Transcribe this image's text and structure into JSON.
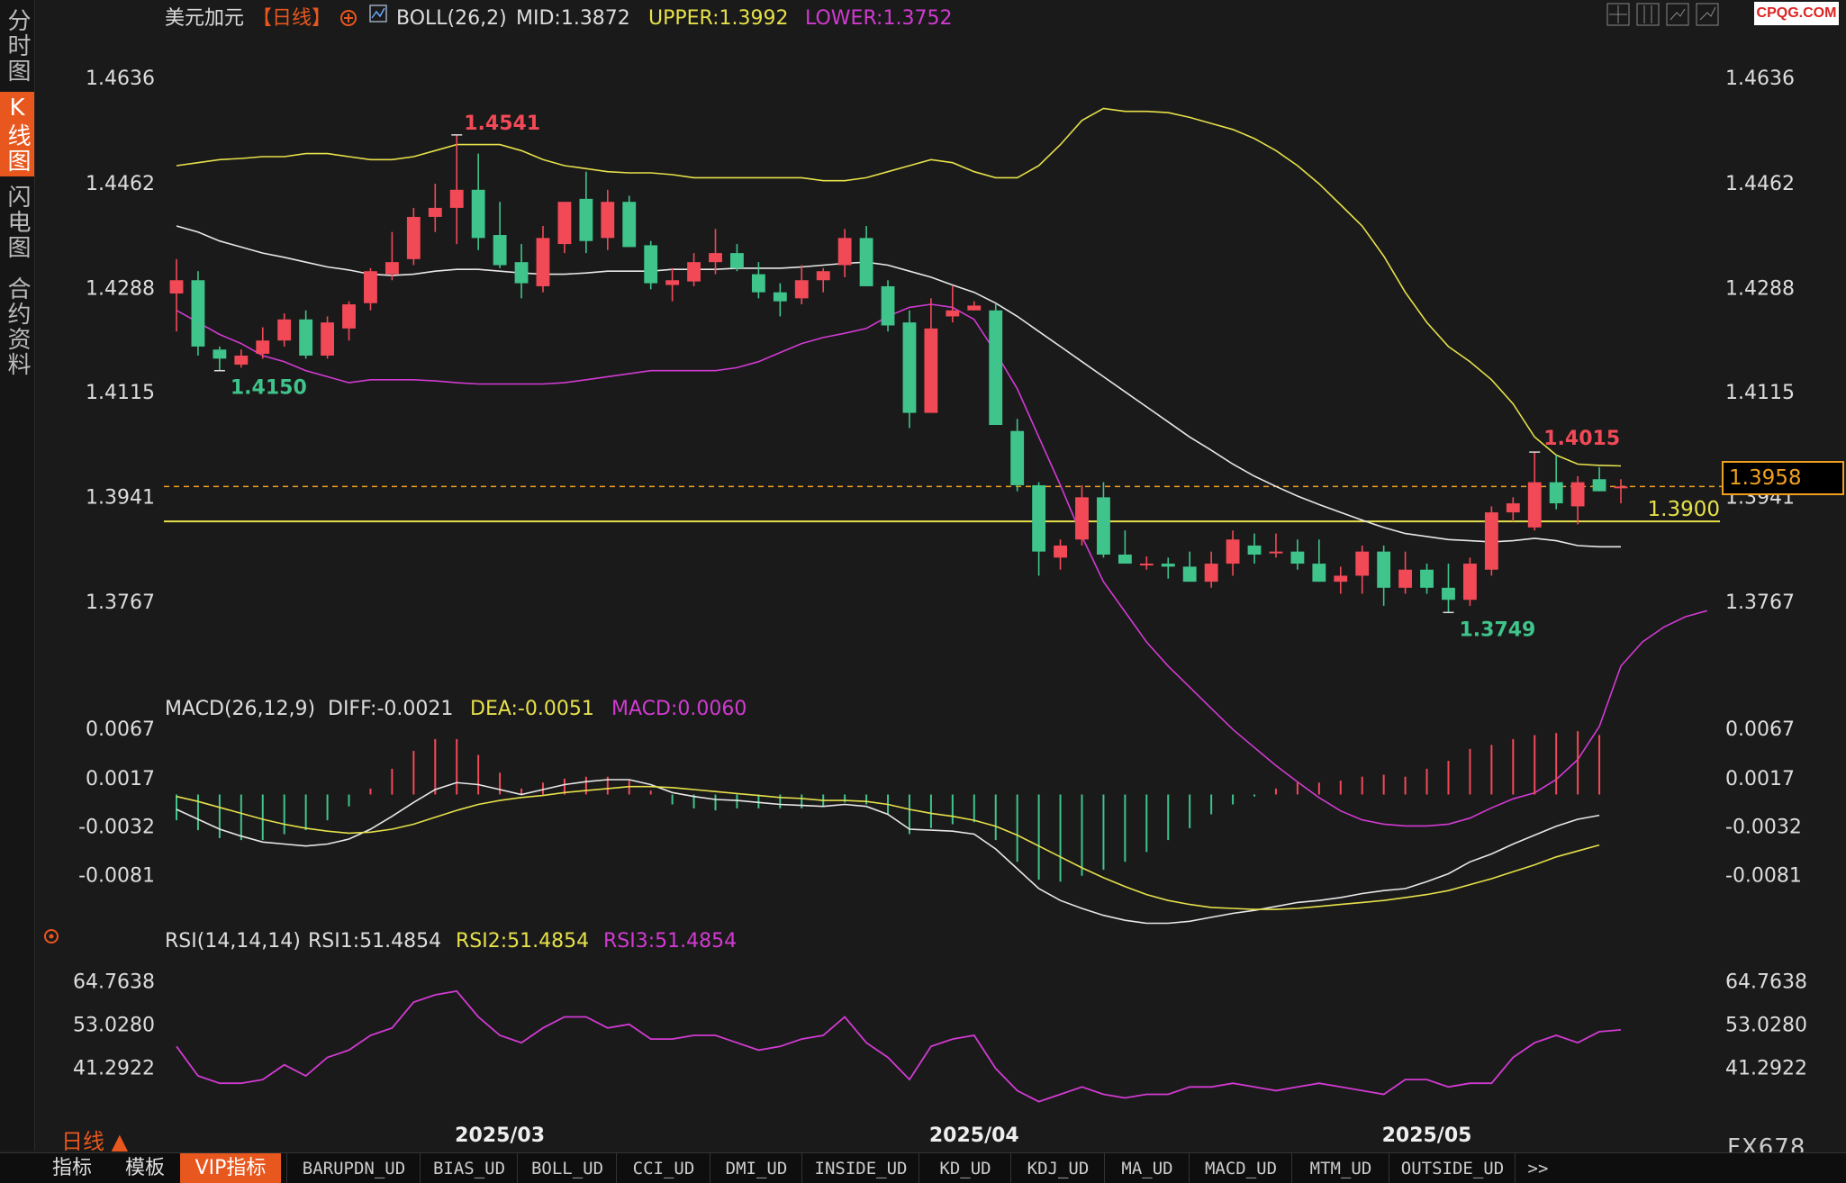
{
  "sidebar": {
    "tabs": [
      {
        "label": "分时图",
        "active": false
      },
      {
        "label": "K线图",
        "active": true
      },
      {
        "label": "闪电图",
        "active": false
      },
      {
        "label": "合约资料",
        "active": false
      }
    ]
  },
  "header": {
    "symbol_title": "美元加元",
    "period_tag": "【日线】",
    "boll_label": "BOLL(26,2)",
    "boll_mid": "MID:1.3872",
    "boll_upper": "UPPER:1.3992",
    "boll_lower": "LOWER:1.3752"
  },
  "macd_header": {
    "label": "MACD(26,12,9)",
    "diff": "DIFF:-0.0021",
    "dea": "DEA:-0.0051",
    "macd": "MACD:0.0060"
  },
  "rsi_header": {
    "label": "RSI(14,14,14)",
    "rsi1": "RSI1:51.4854",
    "rsi2": "RSI2:51.4854",
    "rsi3": "RSI3:51.4854"
  },
  "watermark": "CPQG.COM",
  "current_price": "1.3958",
  "brand": "FX678",
  "period_label": "日线 ▲",
  "bottom_tabs": {
    "indicators": "指标",
    "templates": "模板",
    "vip": "VIP指标"
  },
  "indicator_tabs": [
    "BARUPDN_UD",
    "BIAS_UD",
    "BOLL_UD",
    "CCI_UD",
    "DMI_UD",
    "INSIDE_UD",
    "KD_UD",
    "KDJ_UD",
    "MA_UD",
    "MACD_UD",
    "MTM_UD",
    "OUTSIDE_UD",
    ">>"
  ],
  "colors": {
    "up": "#f24957",
    "down": "#3fc48b",
    "mid": "#e8e8e8",
    "upper": "#e6e04a",
    "lower": "#d23ad2",
    "accent": "#e8571e"
  },
  "chart_data": [
    {
      "type": "candlestick",
      "title": "美元加元【日线】",
      "ylim": [
        1.363,
        1.4705
      ],
      "yticks": [
        "1.4636",
        "1.4462",
        "1.4288",
        "1.4115",
        "1.3941",
        "1.3767"
      ],
      "xticks": [
        "2025/03",
        "2025/04",
        "2025/05"
      ],
      "annotations": {
        "high": "1.4541",
        "low_left": "1.4150",
        "low_right": "1.3749",
        "recent_high": "1.4015",
        "hline": "1.3900"
      },
      "hline_value": 1.39,
      "dashed_line_value": 1.3958,
      "ohlc": [
        [
          1.4278,
          1.4335,
          1.4215,
          1.43
        ],
        [
          1.43,
          1.4315,
          1.4175,
          1.419
        ],
        [
          1.4185,
          1.419,
          1.415,
          1.417
        ],
        [
          1.416,
          1.4185,
          1.4155,
          1.4175
        ],
        [
          1.4178,
          1.4222,
          1.417,
          1.42
        ],
        [
          1.42,
          1.4245,
          1.419,
          1.4235
        ],
        [
          1.4235,
          1.425,
          1.417,
          1.4175
        ],
        [
          1.4175,
          1.424,
          1.417,
          1.423
        ],
        [
          1.422,
          1.4265,
          1.42,
          1.426
        ],
        [
          1.4262,
          1.432,
          1.425,
          1.4315
        ],
        [
          1.431,
          1.438,
          1.43,
          1.433
        ],
        [
          1.4335,
          1.442,
          1.4325,
          1.4405
        ],
        [
          1.4405,
          1.446,
          1.438,
          1.442
        ],
        [
          1.442,
          1.4541,
          1.436,
          1.445
        ],
        [
          1.445,
          1.451,
          1.435,
          1.437
        ],
        [
          1.4375,
          1.443,
          1.432,
          1.4325
        ],
        [
          1.433,
          1.436,
          1.427,
          1.4295
        ],
        [
          1.429,
          1.439,
          1.428,
          1.437
        ],
        [
          1.436,
          1.442,
          1.4345,
          1.443
        ],
        [
          1.4435,
          1.448,
          1.4345,
          1.4365
        ],
        [
          1.437,
          1.445,
          1.435,
          1.443
        ],
        [
          1.443,
          1.444,
          1.4355,
          1.4355
        ],
        [
          1.4358,
          1.4365,
          1.4285,
          1.4295
        ],
        [
          1.4292,
          1.432,
          1.4265,
          1.43
        ],
        [
          1.4298,
          1.4345,
          1.429,
          1.433
        ],
        [
          1.433,
          1.4385,
          1.431,
          1.4345
        ],
        [
          1.4345,
          1.436,
          1.4315,
          1.432
        ],
        [
          1.431,
          1.433,
          1.427,
          1.428
        ],
        [
          1.428,
          1.4295,
          1.424,
          1.4265
        ],
        [
          1.427,
          1.4325,
          1.426,
          1.43
        ],
        [
          1.43,
          1.432,
          1.428,
          1.4315
        ],
        [
          1.4325,
          1.4385,
          1.4305,
          1.437
        ],
        [
          1.437,
          1.439,
          1.429,
          1.429
        ],
        [
          1.429,
          1.43,
          1.4215,
          1.4225
        ],
        [
          1.423,
          1.425,
          1.4055,
          1.408
        ],
        [
          1.408,
          1.427,
          1.408,
          1.422
        ],
        [
          1.424,
          1.429,
          1.423,
          1.425
        ],
        [
          1.425,
          1.4265,
          1.425,
          1.4258
        ],
        [
          1.425,
          1.426,
          1.406,
          1.406
        ],
        [
          1.405,
          1.407,
          1.395,
          1.396
        ],
        [
          1.396,
          1.3965,
          1.381,
          1.385
        ],
        [
          1.384,
          1.387,
          1.382,
          1.386
        ],
        [
          1.387,
          1.396,
          1.386,
          1.394
        ],
        [
          1.394,
          1.3965,
          1.384,
          1.3845
        ],
        [
          1.3845,
          1.3885,
          1.383,
          1.383
        ],
        [
          1.383,
          1.3842,
          1.382,
          1.383
        ],
        [
          1.383,
          1.384,
          1.3805,
          1.3825
        ],
        [
          1.3825,
          1.385,
          1.38,
          1.38
        ],
        [
          1.38,
          1.385,
          1.379,
          1.383
        ],
        [
          1.383,
          1.3885,
          1.381,
          1.387
        ],
        [
          1.386,
          1.388,
          1.383,
          1.3845
        ],
        [
          1.385,
          1.388,
          1.384,
          1.385
        ],
        [
          1.385,
          1.387,
          1.382,
          1.383
        ],
        [
          1.383,
          1.387,
          1.38,
          1.38
        ],
        [
          1.38,
          1.3825,
          1.378,
          1.381
        ],
        [
          1.381,
          1.386,
          1.378,
          1.385
        ],
        [
          1.385,
          1.386,
          1.376,
          1.379
        ],
        [
          1.379,
          1.385,
          1.378,
          1.382
        ],
        [
          1.382,
          1.383,
          1.378,
          1.379
        ],
        [
          1.379,
          1.383,
          1.3749,
          1.377
        ],
        [
          1.377,
          1.384,
          1.376,
          1.383
        ],
        [
          1.382,
          1.3925,
          1.381,
          1.3915
        ],
        [
          1.3915,
          1.394,
          1.39,
          1.393
        ],
        [
          1.389,
          1.4015,
          1.3885,
          1.3965
        ],
        [
          1.3965,
          1.401,
          1.392,
          1.393
        ],
        [
          1.3925,
          1.3975,
          1.3895,
          1.3965
        ],
        [
          1.397,
          1.399,
          1.395,
          1.395
        ],
        [
          1.3955,
          1.397,
          1.393,
          1.3958
        ]
      ],
      "boll_mid_values": [
        1.439,
        1.438,
        1.4365,
        1.4355,
        1.4345,
        1.4338,
        1.433,
        1.4322,
        1.4317,
        1.431,
        1.4308,
        1.431,
        1.4315,
        1.4318,
        1.4318,
        1.4315,
        1.4312,
        1.431,
        1.431,
        1.4312,
        1.4315,
        1.4315,
        1.4315,
        1.4318,
        1.4318,
        1.4318,
        1.432,
        1.432,
        1.432,
        1.4322,
        1.4325,
        1.4328,
        1.433,
        1.4325,
        1.4315,
        1.4305,
        1.4292,
        1.428,
        1.4262,
        1.424,
        1.4215,
        1.419,
        1.4165,
        1.414,
        1.4115,
        1.409,
        1.4065,
        1.404,
        1.4018,
        1.3995,
        1.3975,
        1.3958,
        1.3942,
        1.3928,
        1.3915,
        1.3902,
        1.389,
        1.388,
        1.3875,
        1.387,
        1.3868,
        1.3866,
        1.3868,
        1.3872,
        1.3868,
        1.386,
        1.3858,
        1.3858
      ],
      "boll_upper_values": [
        1.449,
        1.4495,
        1.45,
        1.4502,
        1.4505,
        1.4505,
        1.451,
        1.451,
        1.4505,
        1.45,
        1.45,
        1.4505,
        1.4515,
        1.4525,
        1.4525,
        1.4525,
        1.4515,
        1.45,
        1.449,
        1.4485,
        1.448,
        1.4478,
        1.4478,
        1.4475,
        1.447,
        1.447,
        1.447,
        1.447,
        1.447,
        1.447,
        1.4465,
        1.4465,
        1.447,
        1.448,
        1.449,
        1.45,
        1.4495,
        1.448,
        1.447,
        1.447,
        1.449,
        1.4525,
        1.4565,
        1.4585,
        1.458,
        1.458,
        1.4578,
        1.457,
        1.456,
        1.455,
        1.4535,
        1.4515,
        1.449,
        1.446,
        1.4425,
        1.439,
        1.434,
        1.428,
        1.423,
        1.419,
        1.4165,
        1.4135,
        1.4095,
        1.404,
        1.401,
        1.3995,
        1.3993,
        1.3992
      ],
      "boll_lower_values": [
        1.425,
        1.423,
        1.421,
        1.4195,
        1.4175,
        1.4165,
        1.415,
        1.414,
        1.413,
        1.4135,
        1.4135,
        1.4135,
        1.4133,
        1.413,
        1.4128,
        1.4128,
        1.4128,
        1.4128,
        1.413,
        1.4135,
        1.414,
        1.4145,
        1.415,
        1.415,
        1.415,
        1.415,
        1.4155,
        1.4165,
        1.418,
        1.4195,
        1.4205,
        1.4212,
        1.422,
        1.424,
        1.4255,
        1.426,
        1.4255,
        1.4235,
        1.418,
        1.412,
        1.404,
        1.396,
        1.3875,
        1.38,
        1.375,
        1.37,
        1.366,
        1.3625,
        1.359,
        1.3555,
        1.3525,
        1.3495,
        1.3468,
        1.3442,
        1.342,
        1.3405,
        1.3398,
        1.3395,
        1.3395,
        1.3398,
        1.3408,
        1.3425,
        1.344,
        1.345,
        1.3472,
        1.3505,
        1.356,
        1.366,
        1.37,
        1.3725,
        1.3742,
        1.3752
      ]
    },
    {
      "type": "macd",
      "title": "MACD(26,12,9)",
      "ylim": [
        -0.0125,
        0.0075
      ],
      "yticks": [
        "0.0067",
        "0.0017",
        "-0.0032",
        "-0.0081"
      ],
      "series": [
        {
          "name": "DIFF",
          "values": [
            -0.0015,
            -0.0025,
            -0.0035,
            -0.0042,
            -0.0048,
            -0.005,
            -0.0052,
            -0.005,
            -0.0045,
            -0.0035,
            -0.0022,
            -0.0008,
            0.0005,
            0.0012,
            0.001,
            0.0005,
            0.0,
            0.0005,
            0.001,
            0.0013,
            0.0015,
            0.0015,
            0.001,
            0.0002,
            -0.0002,
            -0.0005,
            -0.0006,
            -0.0008,
            -0.001,
            -0.0011,
            -0.0012,
            -0.001,
            -0.0012,
            -0.002,
            -0.0035,
            -0.0036,
            -0.0037,
            -0.004,
            -0.0055,
            -0.0075,
            -0.0095,
            -0.0107,
            -0.0115,
            -0.0122,
            -0.0127,
            -0.013,
            -0.013,
            -0.0128,
            -0.0124,
            -0.012,
            -0.0117,
            -0.0113,
            -0.0109,
            -0.0107,
            -0.0104,
            -0.01,
            -0.0097,
            -0.0095,
            -0.0088,
            -0.008,
            -0.0068,
            -0.006,
            -0.005,
            -0.0041,
            -0.0032,
            -0.0025,
            -0.0021
          ]
        },
        {
          "name": "DEA",
          "values": [
            -0.0002,
            -0.0007,
            -0.0013,
            -0.0019,
            -0.0025,
            -0.003,
            -0.0034,
            -0.0037,
            -0.0039,
            -0.0038,
            -0.0035,
            -0.003,
            -0.0023,
            -0.0016,
            -0.001,
            -0.0006,
            -0.0003,
            -0.0001,
            0.0002,
            0.0004,
            0.0006,
            0.0008,
            0.0008,
            0.0007,
            0.0005,
            0.0003,
            0.0001,
            -0.0001,
            -0.0003,
            -0.0004,
            -0.0006,
            -0.0006,
            -0.0007,
            -0.001,
            -0.0015,
            -0.0019,
            -0.0022,
            -0.0026,
            -0.0032,
            -0.0041,
            -0.0052,
            -0.0063,
            -0.0074,
            -0.0084,
            -0.0093,
            -0.0101,
            -0.0107,
            -0.0111,
            -0.0114,
            -0.0115,
            -0.0116,
            -0.0116,
            -0.0115,
            -0.0113,
            -0.0111,
            -0.0109,
            -0.0107,
            -0.0104,
            -0.0101,
            -0.0097,
            -0.0091,
            -0.0085,
            -0.0078,
            -0.0071,
            -0.0063,
            -0.0057,
            -0.0051
          ]
        },
        {
          "name": "MACD",
          "values": [
            -0.0026,
            -0.0036,
            -0.0044,
            -0.0046,
            -0.0046,
            -0.004,
            -0.0036,
            -0.0026,
            -0.0012,
            0.0006,
            0.0026,
            0.0044,
            0.0056,
            0.0056,
            0.004,
            0.0022,
            0.0006,
            0.0012,
            0.0016,
            0.0018,
            0.0018,
            0.0014,
            0.0004,
            -0.001,
            -0.0014,
            -0.0016,
            -0.0014,
            -0.0014,
            -0.0014,
            -0.0014,
            -0.0012,
            -0.0008,
            -0.001,
            -0.002,
            -0.004,
            -0.0034,
            -0.003,
            -0.0028,
            -0.0046,
            -0.0068,
            -0.0086,
            -0.0088,
            -0.0082,
            -0.0076,
            -0.0068,
            -0.0058,
            -0.0046,
            -0.0034,
            -0.002,
            -0.001,
            -0.0002,
            0.0006,
            0.0012,
            0.0012,
            0.0014,
            0.0018,
            0.002,
            0.0018,
            0.0026,
            0.0034,
            0.0046,
            0.005,
            0.0056,
            0.006,
            0.0062,
            0.0064,
            0.006
          ]
        }
      ]
    },
    {
      "type": "line",
      "title": "RSI(14,14,14)",
      "ylim": [
        28,
        72
      ],
      "yticks": [
        "64.7638",
        "53.0280",
        "41.2922"
      ],
      "series": [
        {
          "name": "RSI1",
          "values": [
            47,
            39,
            37,
            37,
            38,
            42,
            39,
            44,
            46,
            50,
            52,
            59,
            61,
            62,
            55,
            50,
            48,
            52,
            55,
            55,
            52,
            53,
            49,
            49,
            50,
            50,
            48,
            46,
            47,
            49,
            50,
            55,
            48,
            44,
            38,
            47,
            49,
            50,
            41,
            35,
            32,
            34,
            36,
            34,
            33,
            34,
            34,
            36,
            36,
            37,
            36,
            35,
            36,
            37,
            36,
            35,
            34,
            38,
            38,
            36,
            37,
            37,
            44,
            48,
            50,
            48,
            51,
            51.4854
          ]
        }
      ]
    }
  ]
}
